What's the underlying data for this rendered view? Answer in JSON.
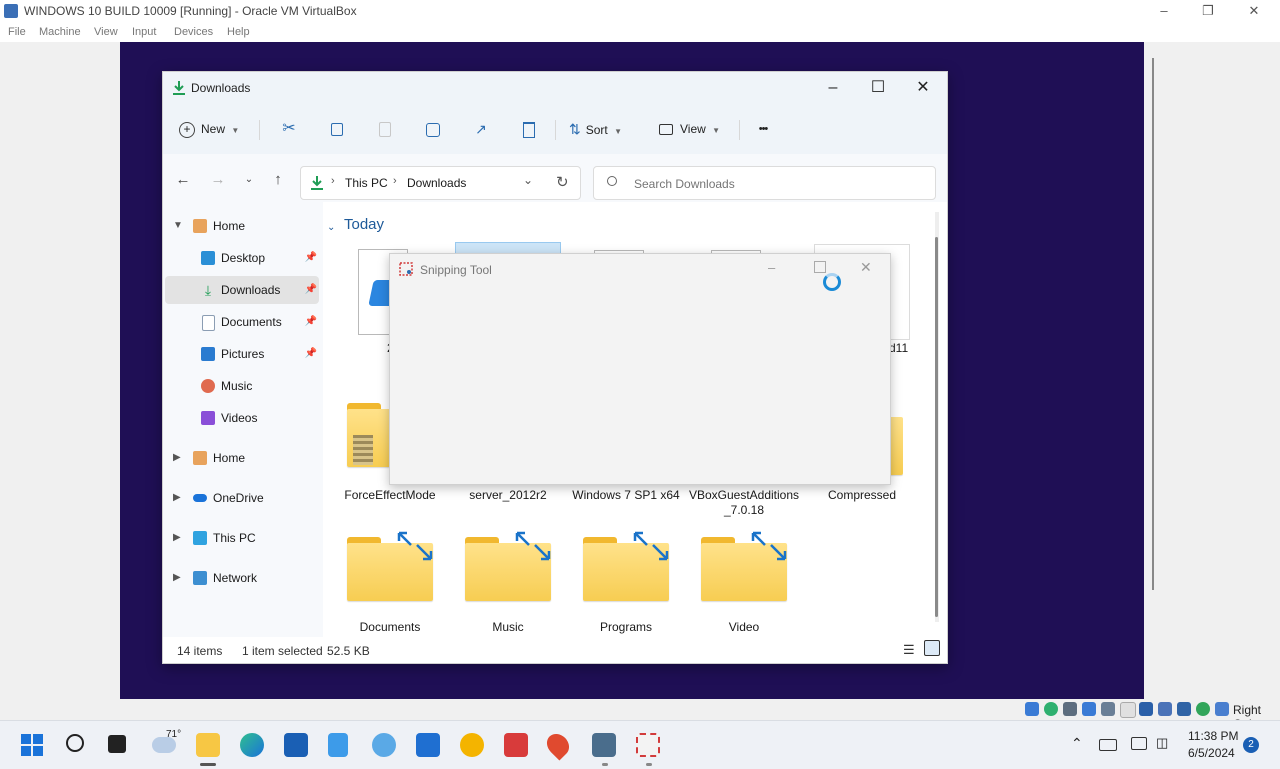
{
  "host": {
    "title": "WINDOWS 10 BUILD 10009 [Running] - Oracle VM VirtualBox",
    "menu": [
      "File",
      "Machine",
      "View",
      "Input",
      "Devices",
      "Help"
    ],
    "status_right": "Right Ctrl"
  },
  "explorer": {
    "title": "Downloads",
    "toolbar": {
      "new_label": "New",
      "sort_label": "Sort",
      "view_label": "View",
      "more": "•••"
    },
    "breadcrumb": [
      "This PC",
      "Downloads"
    ],
    "search_placeholder": "Search Downloads",
    "nav": [
      {
        "label": "Home",
        "expanded": true
      },
      {
        "label": "Desktop",
        "pinned": true
      },
      {
        "label": "Downloads",
        "pinned": true,
        "selected": true
      },
      {
        "label": "Documents",
        "pinned": true
      },
      {
        "label": "Pictures",
        "pinned": true
      },
      {
        "label": "Music"
      },
      {
        "label": "Videos"
      },
      {
        "label": "Home"
      },
      {
        "label": "OneDrive"
      },
      {
        "label": "This PC"
      },
      {
        "label": "Network"
      }
    ],
    "group_label": "Today",
    "row1_partial": [
      "2",
      "d11"
    ],
    "row2": [
      {
        "label": "ForceEffectMode"
      },
      {
        "label": "server_2012r2"
      },
      {
        "label": "Windows 7 SP1 x64"
      },
      {
        "label": "VBoxGuestAdditions_7.0.18"
      },
      {
        "label": "Compressed"
      }
    ],
    "row3": [
      {
        "label": "Documents"
      },
      {
        "label": "Music"
      },
      {
        "label": "Programs"
      },
      {
        "label": "Video"
      }
    ],
    "status": {
      "items": "14 items",
      "selected": "1 item selected",
      "size": "52.5 KB"
    }
  },
  "snipping_tool": {
    "title": "Snipping Tool"
  },
  "taskbar": {
    "weather_temp": "71°",
    "time": "11:38 PM",
    "date": "6/5/2024",
    "notification_count": "2"
  },
  "colors": {
    "vm_background": "#1f0f55",
    "folder": "#f7cd52",
    "accent": "#0067c0"
  }
}
